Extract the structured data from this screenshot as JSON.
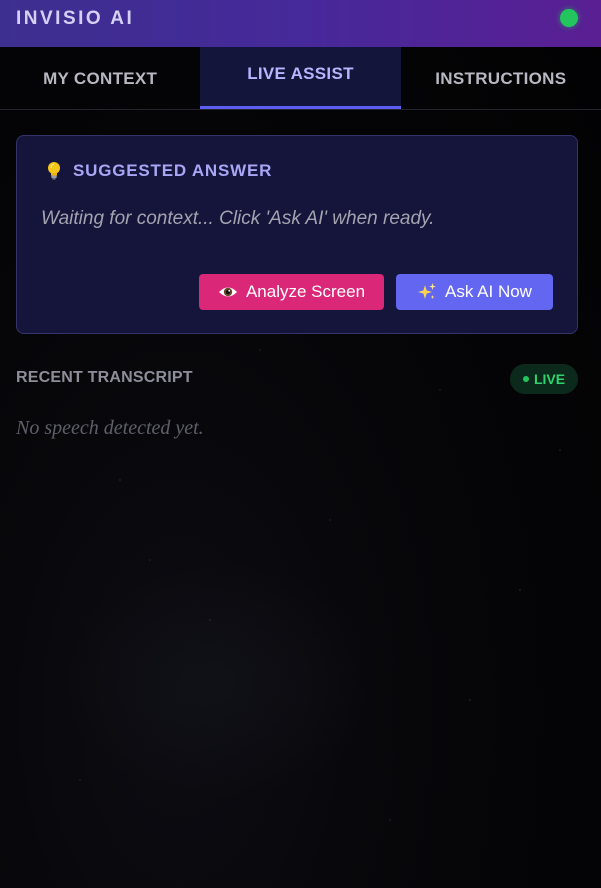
{
  "header": {
    "title": "INVISIO AI",
    "status_color": "#22c55e"
  },
  "tabs": [
    {
      "label": "MY CONTEXT",
      "active": false
    },
    {
      "label": "LIVE ASSIST",
      "active": true
    },
    {
      "label": "INSTRUCTIONS",
      "active": false
    }
  ],
  "suggested": {
    "icon": "lightbulb-icon",
    "title": "SUGGESTED ANSWER",
    "message": "Waiting for context... Click 'Ask AI' when ready.",
    "analyze_button": {
      "icon": "eye-icon",
      "label": "Analyze Screen"
    },
    "ask_button": {
      "icon": "sparkles-icon",
      "label": "Ask AI Now"
    }
  },
  "transcript": {
    "title": "RECENT TRANSCRIPT",
    "badge": "LIVE",
    "empty_text": "No speech detected yet."
  },
  "colors": {
    "accent": "#6366f1",
    "analyze": "#db2777",
    "live": "#22c55e"
  }
}
